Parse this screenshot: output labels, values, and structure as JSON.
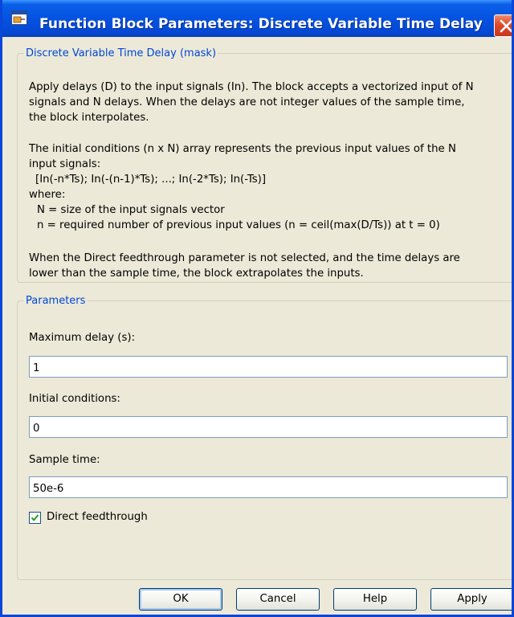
{
  "window": {
    "title": "Function Block Parameters: Discrete Variable Time Delay",
    "icon": "simulink-block-icon",
    "close_icon": "close-icon"
  },
  "description": {
    "legend": "Discrete Variable Time Delay (mask)",
    "p1": [
      "Apply delays (D) to the input signals (In). The block accepts a vectorized input of N",
      "signals and N delays. When the delays are not integer values of the sample time,",
      "the block interpolates."
    ],
    "p2": [
      "The initial conditions (n x N) array represents the previous input values of the N",
      "input signals:",
      "[In(-n*Ts); In(-(n-1)*Ts); ...; In(-2*Ts); In(-Ts)]",
      "where:",
      "N = size of the input signals vector",
      "n = required number of previous input values (n = ceil(max(D/Ts)) at t = 0)"
    ],
    "p3": [
      "When the Direct feedthrough parameter is not selected, and the time delays are",
      "lower than the sample time, the block extrapolates the inputs."
    ]
  },
  "parameters": {
    "legend": "Parameters",
    "max_delay": {
      "label": "Maximum delay (s):",
      "value": "1"
    },
    "initial_conditions": {
      "label": "Initial conditions:",
      "value": "0"
    },
    "sample_time": {
      "label": "Sample time:",
      "value": "50e-6"
    },
    "direct_feedthrough": {
      "label": "Direct feedthrough",
      "checked": true
    }
  },
  "buttons": {
    "ok": "OK",
    "cancel": "Cancel",
    "help": "Help",
    "apply": "Apply"
  },
  "colors": {
    "title_bar": "#0553e0",
    "legend_text": "#0046d5",
    "window_bg": "#ece9d8"
  }
}
